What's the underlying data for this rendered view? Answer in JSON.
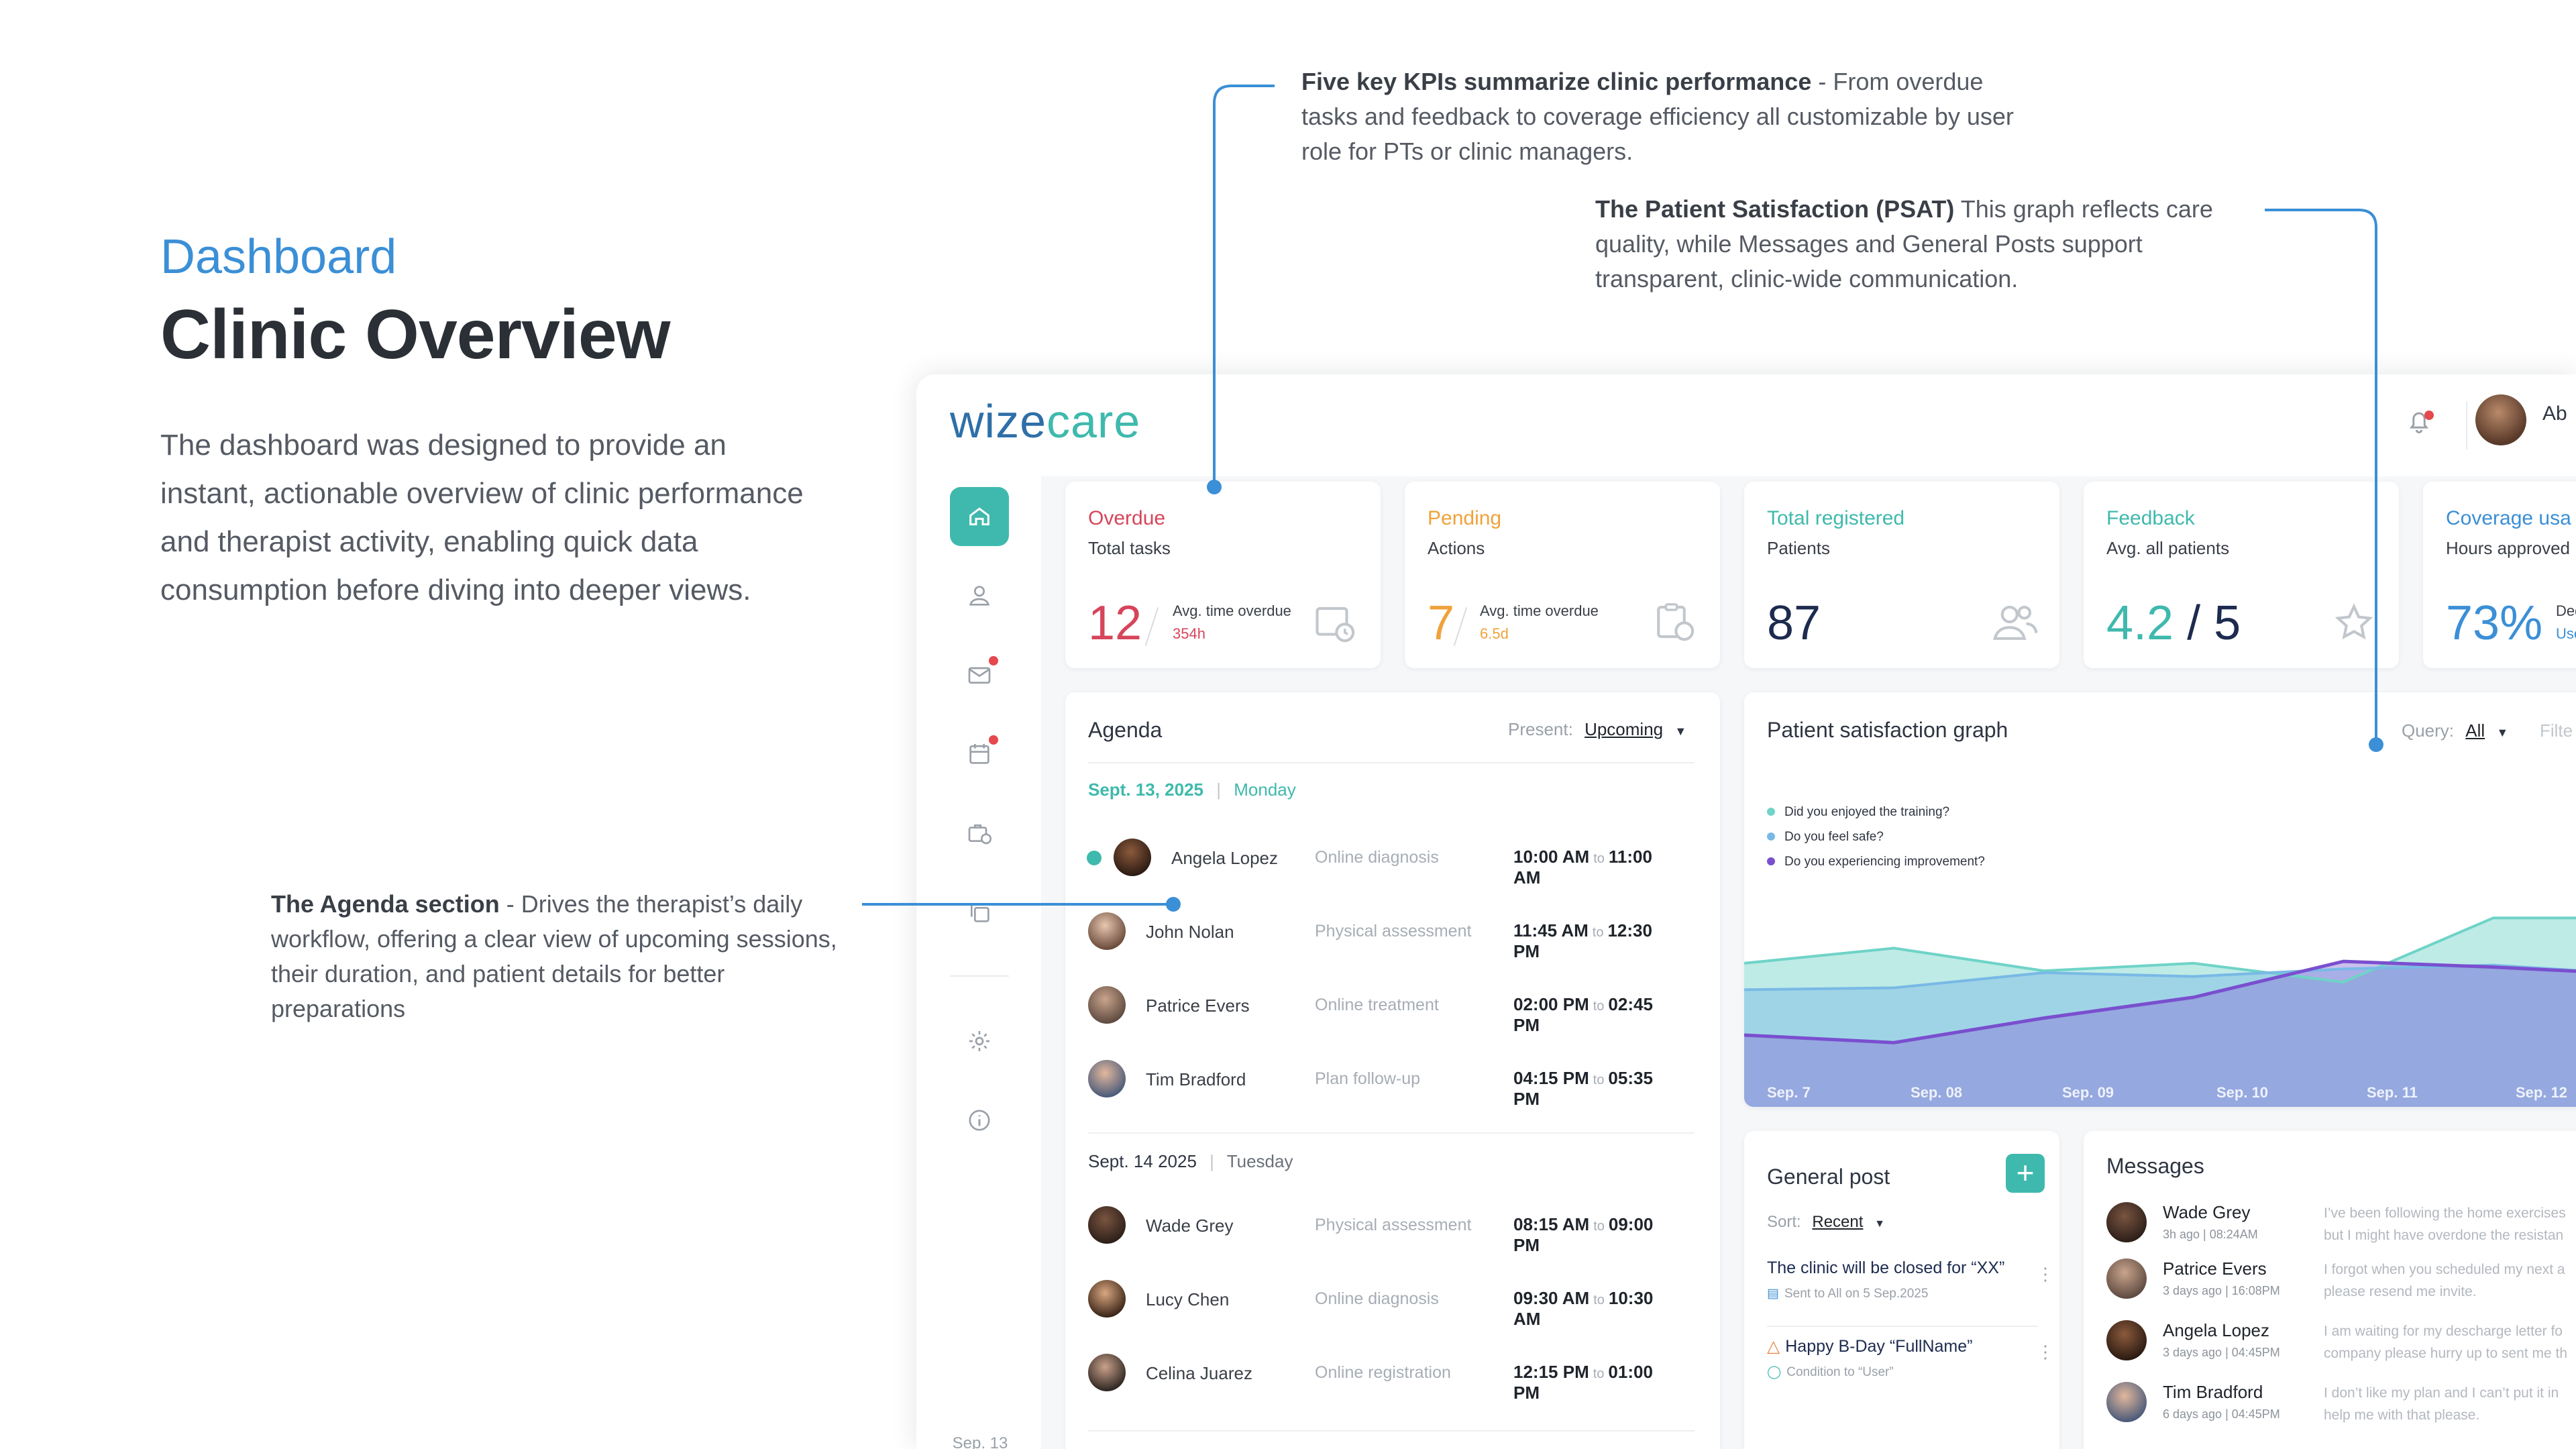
{
  "intro": {
    "eyebrow": "Dashboard",
    "title": "Clinic Overview",
    "description": "The dashboard was designed to provide an instant, actionable overview of clinic performance and therapist activity, enabling quick data consumption before diving into deeper views."
  },
  "annotations": {
    "kpis": {
      "bold": "Five key KPIs summarize clinic performance",
      "text": " - From overdue tasks and feedback to coverage efficiency all customizable by user role for PTs or clinic managers."
    },
    "psat": {
      "bold": "The Patient Satisfaction (PSAT)",
      "text": " This graph reflects care quality, while Messages and General Posts support transparent, clinic-wide communication."
    },
    "agenda": {
      "bold": "The Agenda section",
      "text": " - Drives the therapist’s daily workflow, offering a clear view of upcoming sessions, their duration, and patient details for better preparations"
    }
  },
  "app": {
    "logo_a": "wize",
    "logo_b": "care",
    "user_initials": "Ab",
    "sidebar_date": "Sep. 13"
  },
  "kpis": [
    {
      "title": "Overdue",
      "subtitle": "Total tasks",
      "value": "12",
      "meta_label": "Avg. time overdue",
      "meta_value": "354h",
      "color": "#d6455a",
      "icon": "calendar-clock-icon"
    },
    {
      "title": "Pending",
      "subtitle": "Actions",
      "value": "7",
      "meta_label": "Avg. time overdue",
      "meta_value": "6.5d",
      "color": "#f0a23a",
      "icon": "clipboard-clock-icon"
    },
    {
      "title": "Total registered",
      "subtitle": "Patients",
      "value": "87",
      "color": "#3fb9ad",
      "value_color": "#1d2b4f",
      "icon": "users-icon"
    },
    {
      "title": "Feedback",
      "subtitle": "Avg. all patients",
      "value": "4.2",
      "value_suffix": "/ 5",
      "color": "#3fb9ad",
      "icon": "star-icon"
    },
    {
      "title": "Coverage usa",
      "subtitle": "Hours approved",
      "value": "73%",
      "meta_label": "Dedi",
      "meta_value": "Used",
      "color": "#3b8fd6",
      "icon": ""
    }
  ],
  "agenda": {
    "title": "Agenda",
    "present_label": "Present:",
    "present_value": "Upcoming",
    "day1": {
      "date": "Sept. 13, 2025",
      "weekday": "Monday"
    },
    "day1_rows": [
      {
        "name": "Angela Lopez",
        "type": "Online diagnosis",
        "start": "10:00 AM",
        "sep": "to",
        "end": "11:00 AM"
      },
      {
        "name": "John Nolan",
        "type": "Physical assessment",
        "start": "11:45 AM",
        "sep": "to",
        "end": "12:30 PM"
      },
      {
        "name": "Patrice Evers",
        "type": "Online treatment",
        "start": "02:00 PM",
        "sep": "to",
        "end": "02:45 PM"
      },
      {
        "name": "Tim Bradford",
        "type": "Plan follow-up",
        "start": "04:15 PM",
        "sep": "to",
        "end": "05:35 PM"
      }
    ],
    "day2": {
      "date": "Sept. 14 2025",
      "weekday": "Tuesday"
    },
    "day2_rows": [
      {
        "name": "Wade Grey",
        "type": "Physical assessment",
        "start": "08:15 AM",
        "sep": "to",
        "end": "09:00 PM"
      },
      {
        "name": "Lucy Chen",
        "type": "Online diagnosis",
        "start": "09:30 AM",
        "sep": "to",
        "end": "10:30 AM"
      },
      {
        "name": "Celina Juarez",
        "type": "Online registration",
        "start": "12:15 PM",
        "sep": "to",
        "end": "01:00 PM"
      }
    ]
  },
  "psat": {
    "title": "Patient satisfaction graph",
    "query_label": "Query:",
    "query_value": "All",
    "filter_label": "Filte"
  },
  "chart_data": {
    "type": "area",
    "x": [
      "Sep. 7",
      "Sep. 08",
      "Sep. 09",
      "Sep. 10",
      "Sep. 11",
      "Sep. 12"
    ],
    "series": [
      {
        "name": "Did you enjoyed the training?",
        "color": "#6fd3c7",
        "values": [
          76,
          84,
          72,
          76,
          66,
          100,
          100
        ]
      },
      {
        "name": "Do you feel safe?",
        "color": "#79b9e6",
        "values": [
          62,
          63,
          71,
          69,
          73,
          75,
          70
        ]
      },
      {
        "name": "Do you experiencing improvement?",
        "color": "#7a4fcf",
        "values": [
          38,
          34,
          47,
          58,
          77,
          74,
          70
        ]
      }
    ],
    "ylim": [
      0,
      120
    ]
  },
  "general_post": {
    "title": "General post",
    "sort_label": "Sort:",
    "sort_value": "Recent",
    "posts": [
      {
        "title": "The clinic will be closed for “XX”",
        "meta": "Sent to All on 5 Sep.2025"
      },
      {
        "title": "Happy B-Day “FullName”",
        "meta": "Condition to “User”"
      }
    ]
  },
  "messages": {
    "title": "Messages",
    "items": [
      {
        "name": "Wade Grey",
        "ago": "3h ago | 08:24AM",
        "line1": "I’ve been following the home exercises",
        "line2": "but I might have overdone the resistan"
      },
      {
        "name": "Patrice Evers",
        "ago": "3 days ago | 16:08PM",
        "line1": "I forgot when you scheduled my next a",
        "line2": "please resend me invite."
      },
      {
        "name": "Angela Lopez",
        "ago": "3 days ago | 04:45PM",
        "line1": "I am waiting for my descharge letter fo",
        "line2": "company please hurry up to sent me th"
      },
      {
        "name": "Tim Bradford",
        "ago": "6 days ago | 04:45PM",
        "line1": "I don’t like my plan and I can’t put it in",
        "line2": "help me with that please."
      }
    ]
  }
}
